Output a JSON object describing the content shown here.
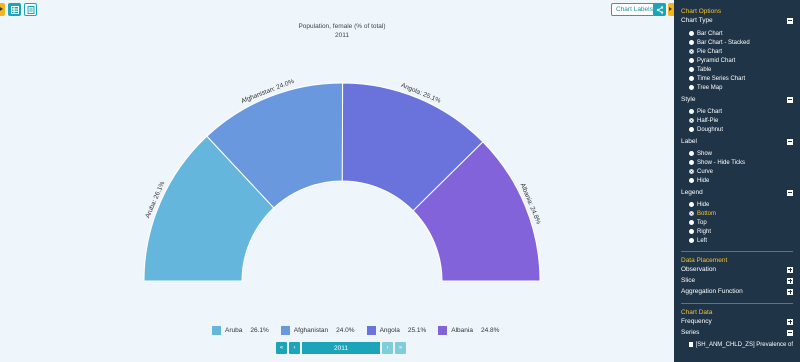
{
  "toolbar": {
    "chart_labels": "Chart Labels",
    "buttons": [
      {
        "icon": "table-icon",
        "active": true
      },
      {
        "icon": "document-icon",
        "active": false
      }
    ]
  },
  "chart": {
    "title": "Population, female (% of total)",
    "subtitle": "2011",
    "colors": {
      "accent": "#1ca5b8",
      "panel": "#1f3447",
      "highlight": "#f3c233"
    }
  },
  "chart_data": {
    "type": "pie",
    "style": "half-pie",
    "categories": [
      "Aruba",
      "Afghanistan",
      "Angola",
      "Albania"
    ],
    "values": [
      26.1,
      24.0,
      25.1,
      24.8
    ],
    "labels": [
      "Aruba: 26.1%",
      "Afghanistan: 24.0%",
      "Angola: 25.1%",
      "Albania: 24.8%"
    ],
    "colors": [
      "#64b6dc",
      "#6a98de",
      "#6a72dc",
      "#8263da"
    ],
    "title": "Population, female (% of total)",
    "subtitle": "2011",
    "legend_position": "bottom"
  },
  "legend": [
    {
      "name": "Aruba",
      "value": "26.1%",
      "color": "#64b6dc"
    },
    {
      "name": "Afghanistan",
      "value": "24.0%",
      "color": "#6a98de"
    },
    {
      "name": "Angola",
      "value": "25.1%",
      "color": "#6a72dc"
    },
    {
      "name": "Albania",
      "value": "24.8%",
      "color": "#8263da"
    }
  ],
  "pager": {
    "first": "«",
    "prev": "‹",
    "year": "2011",
    "next": "›",
    "last": "»"
  },
  "panel": {
    "chart_options_title": "Chart Options",
    "chart_type_label": "Chart Type",
    "chart_types": [
      "Bar Chart",
      "Bar Chart - Stacked",
      "Pie Chart",
      "Pyramid Chart",
      "Table",
      "Time Series Chart",
      "Tree Map"
    ],
    "chart_type_selected": 2,
    "style_label": "Style",
    "styles": [
      "Pie Chart",
      "Half-Pie",
      "Doughnut"
    ],
    "style_selected": 1,
    "label_label": "Label",
    "labels": [
      "Show",
      "Show - Hide Ticks",
      "Curve",
      "Hide"
    ],
    "label_selected": 2,
    "legend_label": "Legend",
    "legends": [
      "Hide",
      "Bottom",
      "Top",
      "Right",
      "Left"
    ],
    "legend_selected": 1,
    "data_placement_title": "Data Placement",
    "observation": "Observation",
    "slice": "Slice",
    "aggregation": "Aggregation Function",
    "chart_data_title": "Chart Data",
    "frequency": "Frequency",
    "series": "Series",
    "series_item": "[SH_ANM_CHLD_ZS] Prevalence of"
  }
}
